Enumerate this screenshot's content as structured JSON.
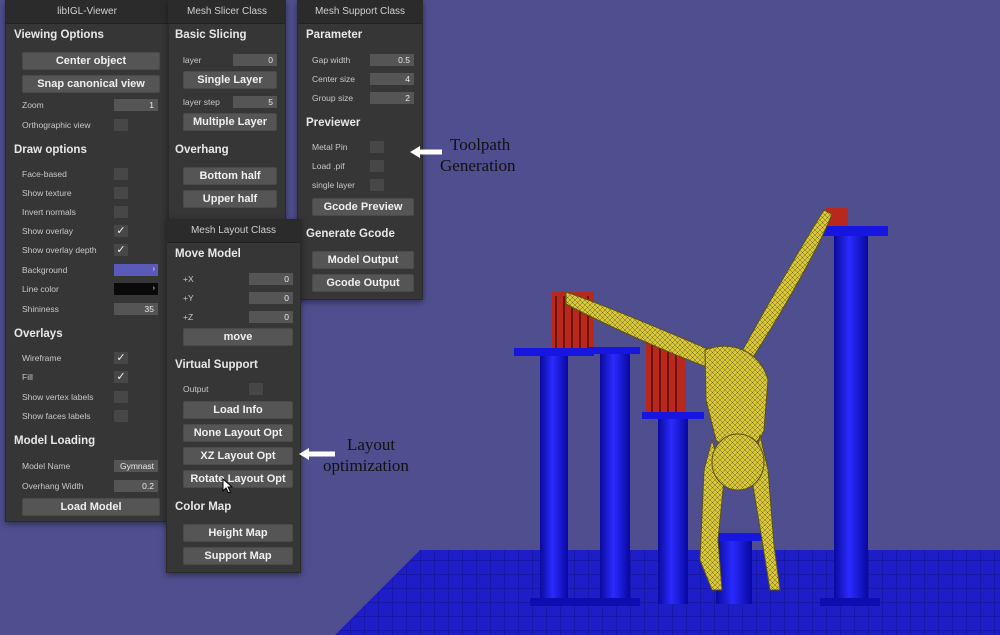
{
  "viewer": {
    "title": "libIGL-Viewer",
    "viewing_options": "Viewing Options",
    "center_object": "Center object",
    "snap_canonical": "Snap canonical view",
    "zoom_label": "Zoom",
    "zoom_value": "1",
    "ortho_label": "Orthographic view",
    "draw_options": "Draw options",
    "face_based": "Face-based",
    "show_texture": "Show texture",
    "invert_normals": "Invert normals",
    "show_overlay": "Show overlay",
    "show_overlay_depth": "Show overlay depth",
    "background_label": "Background",
    "line_color_label": "Line color",
    "shininess_label": "Shininess",
    "shininess_value": "35",
    "overlays": "Overlays",
    "wireframe": "Wireframe",
    "fill": "Fill",
    "vertex_labels": "Show vertex labels",
    "faces_labels": "Show faces labels",
    "model_loading": "Model Loading",
    "model_name_label": "Model Name",
    "model_name_value": "Gymnast",
    "overhang_width_label": "Overhang Width",
    "overhang_width_value": "0.2",
    "load_model": "Load Model",
    "background_color": "#5a5ab8",
    "line_color": "#0a0a0a"
  },
  "slicer": {
    "title": "Mesh Slicer Class",
    "basic_slicing": "Basic Slicing",
    "layer_label": "layer",
    "layer_value": "0",
    "single_layer": "Single Layer",
    "layer_step_label": "layer step",
    "layer_step_value": "5",
    "multiple_layer": "Multiple Layer",
    "overhang": "Overhang",
    "bottom_half": "Bottom half",
    "upper_half": "Upper half"
  },
  "support": {
    "title": "Mesh Support Class",
    "parameter": "Parameter",
    "gap_width_label": "Gap width",
    "gap_width_value": "0.5",
    "center_size_label": "Center size",
    "center_size_value": "4",
    "group_size_label": "Group size",
    "group_size_value": "2",
    "previewer": "Previewer",
    "metal_pin": "Metal Pin",
    "load_pif": "Load .pif",
    "single_layer": "single layer",
    "gcode_preview": "Gcode Preview",
    "generate_gcode": "Generate Gcode",
    "model_output": "Model Output",
    "gcode_output": "Gcode Output"
  },
  "layout": {
    "title": "Mesh Layout Class",
    "move_model": "Move Model",
    "x_label": "+X",
    "x_value": "0",
    "y_label": "+Y",
    "y_value": "0",
    "z_label": "+Z",
    "z_value": "0",
    "move": "move",
    "virtual_support": "Virtual Support",
    "output": "Output",
    "load_info": "Load Info",
    "none_layout": "None Layout Opt",
    "xz_layout": "XZ Layout Opt",
    "rotate_layout": "Rotate Layout Opt",
    "color_map": "Color Map",
    "height_map": "Height Map",
    "support_map": "Support Map"
  },
  "annotations": {
    "toolpath_line1": "Toolpath",
    "toolpath_line2": "Generation",
    "layout_line1": "Layout",
    "layout_line2": "optimization"
  }
}
